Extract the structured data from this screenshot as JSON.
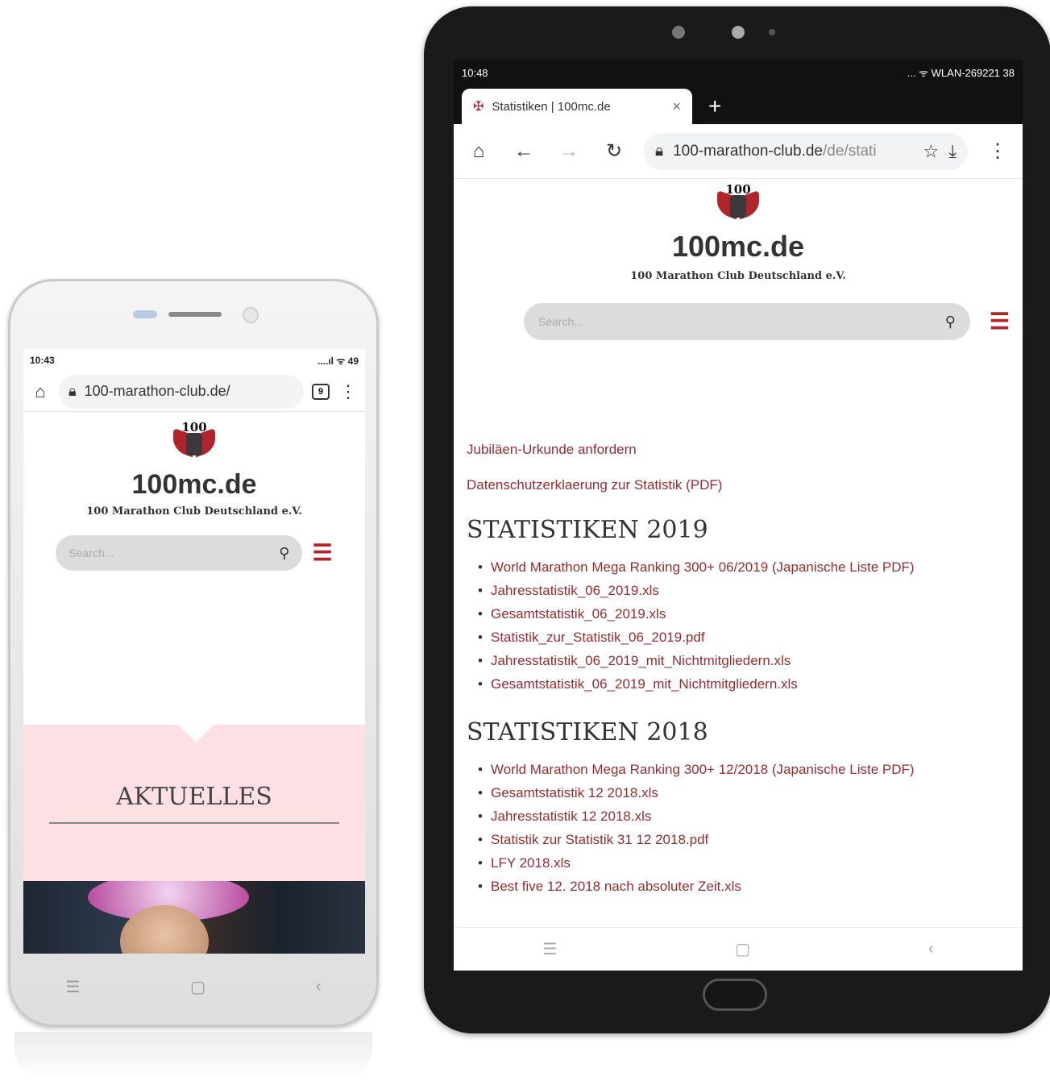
{
  "phone": {
    "status": {
      "time": "10:43",
      "icons": "....ıl ᯤ 49"
    },
    "toolbar": {
      "url": "100-marathon-club.de/",
      "tab_count": "9"
    },
    "site": {
      "logo_text": "100",
      "title": "100mc.de",
      "subtitle": "100 Marathon Club Deutschland e.V."
    },
    "search": {
      "placeholder": "Search..."
    },
    "section": {
      "title": "AKTUELLES"
    },
    "nav": {
      "menu": "☰",
      "home": "▢",
      "back": "‹"
    }
  },
  "tablet": {
    "status": {
      "time": "10:48",
      "icons": "... ᯤ WLAN-269221 38"
    },
    "tab": {
      "title": "Statistiken | 100mc.de",
      "close": "×",
      "new": "+"
    },
    "toolbar": {
      "url_main": "100-marathon-club.de",
      "url_dim": "/de/stati"
    },
    "site": {
      "logo_text": "100",
      "title": "100mc.de",
      "subtitle": "100 Marathon Club Deutschland e.V."
    },
    "search": {
      "placeholder": "Search..."
    },
    "links": [
      "Jubiläen-Urkunde anfordern",
      "Datenschutzerklaerung zur Statistik (PDF)"
    ],
    "sections": [
      {
        "title": "STATISTIKEN 2019",
        "items": [
          "World Marathon Mega Ranking 300+ 06/2019 (Japanische Liste PDF)",
          "Jahresstatistik_06_2019.xls",
          "Gesamtstatistik_06_2019.xls",
          "Statistik_zur_Statistik_06_2019.pdf",
          "Jahresstatistik_06_2019_mit_Nichtmitgliedern.xls",
          "Gesamtstatistik_06_2019_mit_Nichtmitgliedern.xls"
        ]
      },
      {
        "title": "STATISTIKEN 2018",
        "items": [
          "World Marathon Mega Ranking 300+ 12/2018 (Japanische Liste PDF)",
          "Gesamtstatistik 12 2018.xls",
          "Jahresstatistik 12 2018.xls",
          "Statistik zur Statistik 31 12 2018.pdf",
          "LFY 2018.xls",
          "Best five 12. 2018 nach absoluter Zeit.xls"
        ]
      }
    ],
    "nav": {
      "menu": "☰",
      "home": "▢",
      "back": "‹"
    }
  },
  "colors": {
    "brand_red": "#b3232b",
    "link": "#9b2b2b",
    "aktuelles_bg": "#fde0e3"
  }
}
